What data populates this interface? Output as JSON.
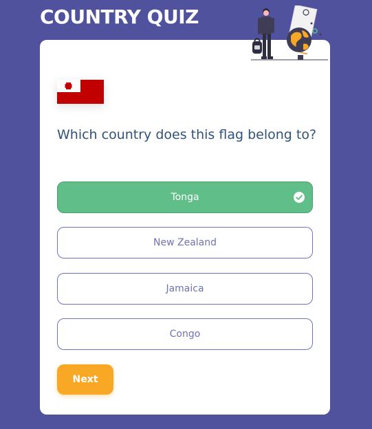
{
  "app": {
    "title": "COUNTRY QUIZ"
  },
  "quiz": {
    "flag_country": "Tonga",
    "question": "Which country does this flag belong to?",
    "options": [
      {
        "label": "Tonga",
        "state": "correct"
      },
      {
        "label": "New Zealand",
        "state": "default"
      },
      {
        "label": "Jamaica",
        "state": "default"
      },
      {
        "label": "Congo",
        "state": "default"
      }
    ],
    "next_label": "Next"
  },
  "colors": {
    "background": "#50529e",
    "correct": "#60bf88",
    "accent": "#f9a826",
    "question_text": "#2f527b",
    "option_border": "#6e71c6"
  },
  "icons": {
    "correct_option": "check-circle-icon",
    "illustration": "traveler-globe-illustration"
  }
}
